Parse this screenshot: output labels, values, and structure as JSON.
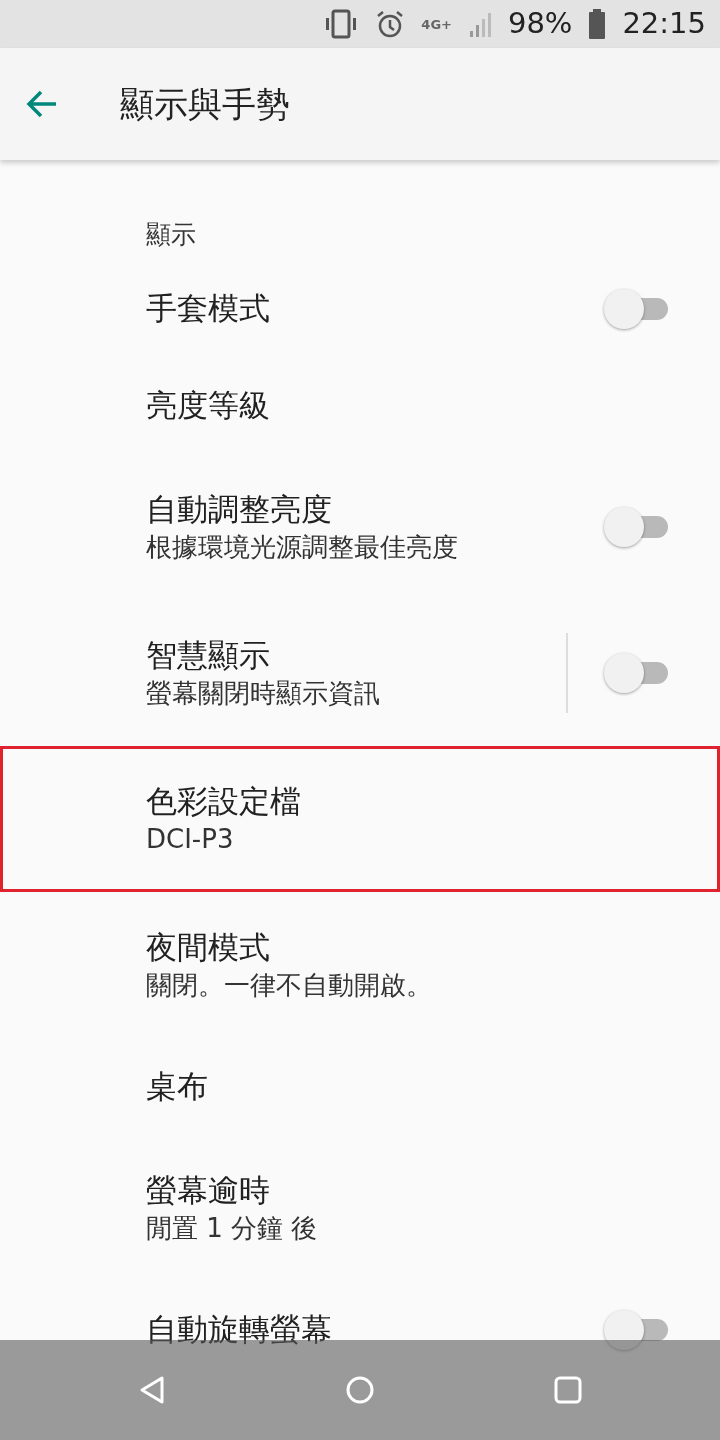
{
  "status_bar": {
    "network": "4G+",
    "battery": "98%",
    "time": "22:15"
  },
  "app_bar": {
    "title": "顯示與手勢"
  },
  "section": {
    "title": "顯示"
  },
  "items": [
    {
      "kind": "switch",
      "title": "手套模式",
      "on": false,
      "highlighted": false
    },
    {
      "kind": "plain",
      "title": "亮度等級",
      "highlighted": false
    },
    {
      "kind": "switch",
      "title": "自動調整亮度",
      "subtitle": "根據環境光源調整最佳亮度",
      "on": false,
      "highlighted": false
    },
    {
      "kind": "split-switch",
      "title": "智慧顯示",
      "subtitle": "螢幕關閉時顯示資訊",
      "on": false,
      "highlighted": false
    },
    {
      "kind": "plain",
      "title": "色彩設定檔",
      "subtitle": "DCI-P3",
      "highlighted": true
    },
    {
      "kind": "plain",
      "title": "夜間模式",
      "subtitle": "關閉。一律不自動開啟。",
      "highlighted": false
    },
    {
      "kind": "plain",
      "title": "桌布",
      "highlighted": false
    },
    {
      "kind": "plain",
      "title": "螢幕逾時",
      "subtitle": "閒置 1 分鐘 後",
      "highlighted": false
    },
    {
      "kind": "switch",
      "title": "自動旋轉螢幕",
      "on": false,
      "highlighted": false
    }
  ]
}
